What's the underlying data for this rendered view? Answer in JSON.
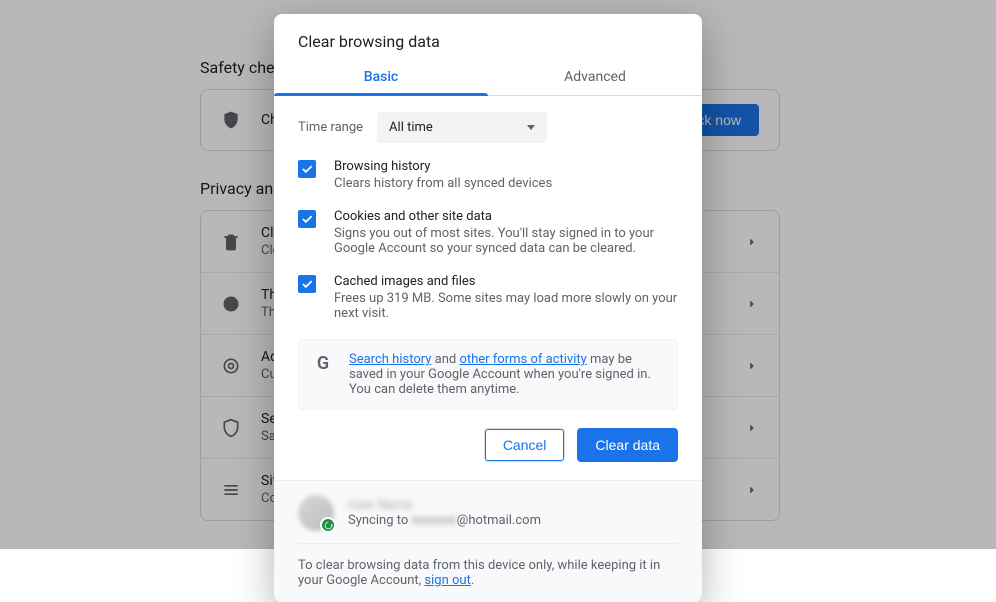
{
  "background": {
    "safety_check_title": "Safety check",
    "safety_row_text": "Chrome",
    "check_now": "Check now",
    "privacy_title": "Privacy and security",
    "rows": [
      {
        "title": "Clear browsing data",
        "sub": "Clear history, cookies, cache, and more"
      },
      {
        "title": "Third-party cookies",
        "sub": "Third-party cookies are blocked in Incognito mode"
      },
      {
        "title": "Ad privacy",
        "sub": "Customize the info used by sites to show you ads"
      },
      {
        "title": "Security",
        "sub": "Safe Browsing and other security settings"
      },
      {
        "title": "Site settings",
        "sub": "Controls what information sites can use and show"
      }
    ]
  },
  "dialog": {
    "title": "Clear browsing data",
    "tab_basic": "Basic",
    "tab_advanced": "Advanced",
    "time_range_label": "Time range",
    "time_range_value": "All time",
    "items": [
      {
        "title": "Browsing history",
        "sub": "Clears history from all synced devices"
      },
      {
        "title": "Cookies and other site data",
        "sub": "Signs you out of most sites. You'll stay signed in to your Google Account so your synced data can be cleared."
      },
      {
        "title": "Cached images and files",
        "sub": "Frees up 319 MB. Some sites may load more slowly on your next visit."
      }
    ],
    "info_link1": "Search history",
    "info_mid1": " and ",
    "info_link2": "other forms of activity",
    "info_rest": " may be saved in your Google Account when you're signed in. You can delete them anytime.",
    "cancel": "Cancel",
    "clear": "Clear data",
    "acct_name": "User Name",
    "sync_prefix": "Syncing to ",
    "sync_blur": "xxxxxxx",
    "sync_suffix": "@hotmail.com",
    "sign_out_pre": "To clear browsing data from this device only, while keeping it in your Google Account, ",
    "sign_out_link": "sign out",
    "sign_out_post": "."
  }
}
